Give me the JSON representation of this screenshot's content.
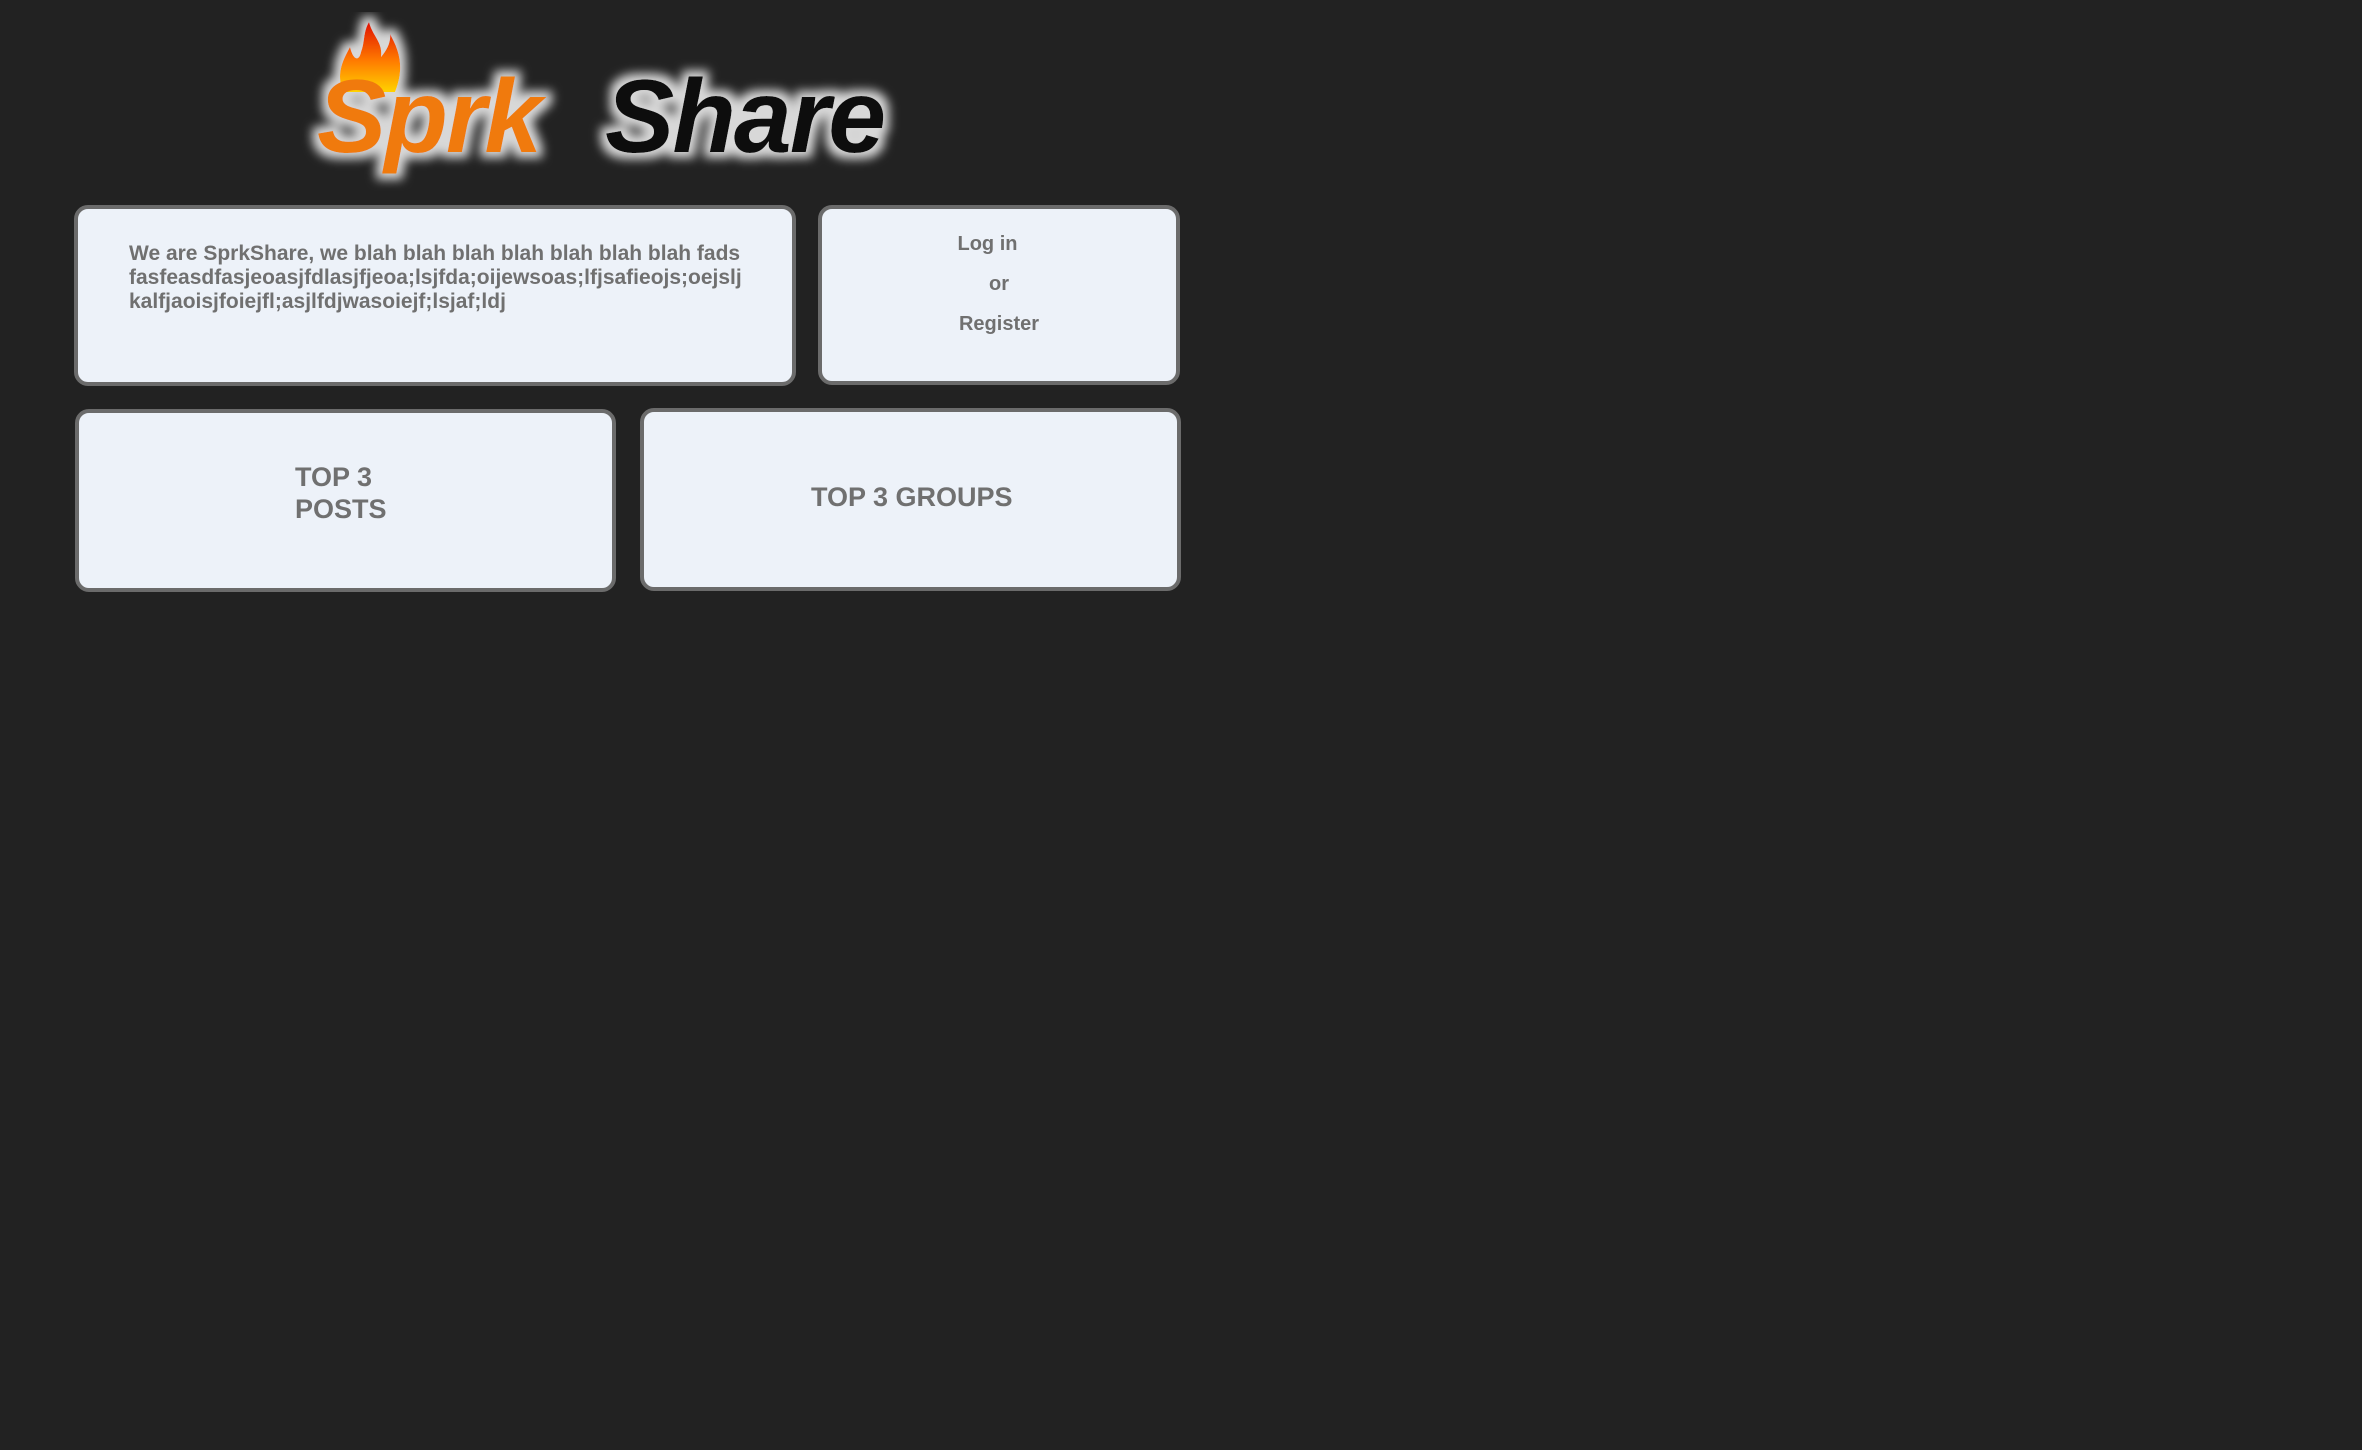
{
  "brand": {
    "logo_part1": "Sprk",
    "logo_part2": "Share"
  },
  "about": {
    "text": "We are SprkShare, we blah blah blah blah blah blah blah fadsfasfeasdfasjeoasjfdlasjfjeoa;lsjfda;oijewsoas;lfjsafieojs;oejsljkalfjaoisjfoiejfl;asjlfdjwasoiejf;lsjaf;ldj"
  },
  "auth": {
    "login_label": "Log in",
    "or_label": "or",
    "register_label": "Register"
  },
  "sections": {
    "top_posts_title": "TOP 3 POSTS",
    "top_groups_title": "TOP 3 GROUPS"
  },
  "colors": {
    "background": "#222222",
    "panel": "#edf2f9",
    "panel_border": "#6b6b6b",
    "text": "#707070",
    "brand_orange": "#f07a10",
    "brand_black": "#111111"
  }
}
